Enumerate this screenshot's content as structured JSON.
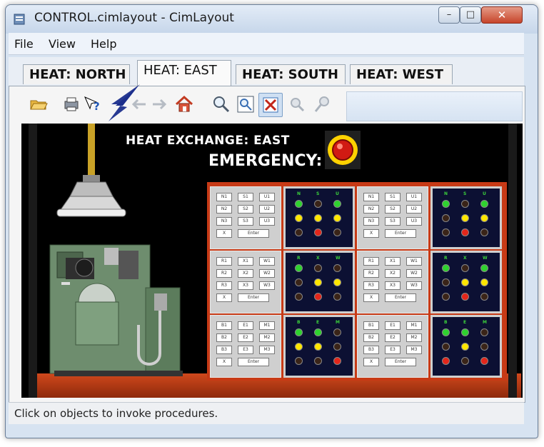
{
  "window": {
    "title": "CONTROL.cimlayout - CimLayout",
    "buttons": {
      "minimize": "–",
      "maximize": "□",
      "close": "✕"
    }
  },
  "menu": [
    "File",
    "View",
    "Help"
  ],
  "tabs": [
    {
      "label": "HEAT: NORTH",
      "active": false
    },
    {
      "label": "HEAT: EAST",
      "active": true
    },
    {
      "label": "HEAT: SOUTH",
      "active": false
    },
    {
      "label": "HEAT: WEST",
      "active": false
    }
  ],
  "toolbar": {
    "icons": [
      "open-folder-icon",
      "print-icon",
      "help-pointer-icon",
      "back-arrow-icon",
      "forward-arrow-icon",
      "home-icon",
      "zoom-icon",
      "zoom-window-icon",
      "select-zoom-icon",
      "pan-icon",
      "pin-icon"
    ]
  },
  "scene": {
    "title": "HEAT EXCHANGE: EAST",
    "emergency_label": "EMERGENCY:",
    "colors": {
      "panel": "#c73a16",
      "lamp_green": "#2fd22f",
      "lamp_yellow": "#ffe600",
      "lamp_red": "#e3261b",
      "lamp_off": "#3a2418",
      "lightbox_bg": "#0c1033"
    },
    "keypads": [
      {
        "keys": [
          "N1",
          "S1",
          "U1",
          "N2",
          "S2",
          "U2",
          "N3",
          "S3",
          "U3",
          "X",
          "Enter"
        ]
      },
      {
        "keys": [
          "N1",
          "S1",
          "U1",
          "N2",
          "S2",
          "U2",
          "N3",
          "S3",
          "U3",
          "X",
          "Enter"
        ]
      },
      {
        "keys": [
          "R1",
          "X1",
          "W1",
          "R2",
          "X2",
          "W2",
          "R3",
          "X3",
          "W3",
          "X",
          "Enter"
        ]
      },
      {
        "keys": [
          "R1",
          "X1",
          "W1",
          "R2",
          "X2",
          "W2",
          "R3",
          "X3",
          "W3",
          "X",
          "Enter"
        ]
      },
      {
        "keys": [
          "B1",
          "E1",
          "M1",
          "B2",
          "E2",
          "M2",
          "B3",
          "E3",
          "M3",
          "X",
          "Enter"
        ]
      },
      {
        "keys": [
          "B1",
          "E1",
          "M1",
          "B2",
          "E2",
          "M2",
          "B3",
          "E3",
          "M3",
          "X",
          "Enter"
        ]
      }
    ],
    "lightboxes": [
      {
        "labels": [
          "N",
          "S",
          "U"
        ],
        "lamps": [
          "G",
          "O",
          "G",
          "Y",
          "Y",
          "Y",
          "O",
          "R",
          "O"
        ]
      },
      {
        "labels": [
          "N",
          "S",
          "U"
        ],
        "lamps": [
          "G",
          "O",
          "G",
          "O",
          "Y",
          "Y",
          "O",
          "R",
          "O"
        ]
      },
      {
        "labels": [
          "R",
          "X",
          "W"
        ],
        "lamps": [
          "G",
          "O",
          "O",
          "O",
          "Y",
          "Y",
          "O",
          "R",
          "O"
        ]
      },
      {
        "labels": [
          "R",
          "X",
          "W"
        ],
        "lamps": [
          "G",
          "O",
          "G",
          "O",
          "Y",
          "Y",
          "O",
          "R",
          "O"
        ]
      },
      {
        "labels": [
          "B",
          "E",
          "M"
        ],
        "lamps": [
          "G",
          "G",
          "O",
          "Y",
          "Y",
          "O",
          "O",
          "O",
          "R"
        ]
      },
      {
        "labels": [
          "B",
          "E",
          "M"
        ],
        "lamps": [
          "G",
          "G",
          "O",
          "O",
          "Y",
          "O",
          "R",
          "O",
          "R"
        ]
      }
    ]
  },
  "status": "Click on objects to invoke procedures."
}
